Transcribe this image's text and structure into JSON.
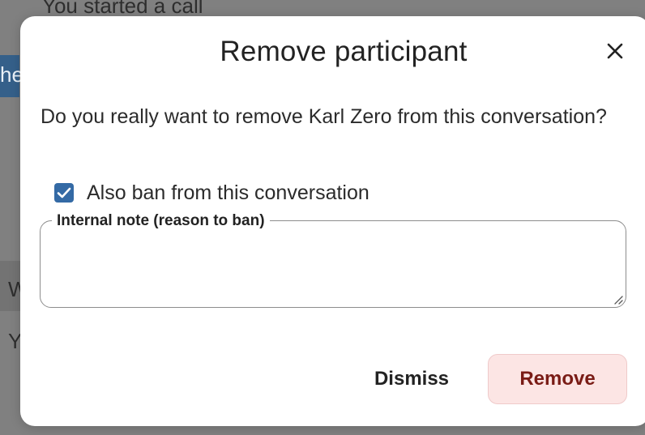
{
  "background": {
    "line_call": "You started a call",
    "line_blue": "he",
    "line_w": "W",
    "line_y": "Y"
  },
  "dialog": {
    "title": "Remove participant",
    "close_icon": "close-icon",
    "message": "Do you really want to remove Karl Zero from this conversation?",
    "ban_checkbox": {
      "checked": true,
      "label": "Also ban from this conversation"
    },
    "note": {
      "label": "Internal note (reason to ban)",
      "value": ""
    },
    "dismiss_label": "Dismiss",
    "remove_label": "Remove"
  },
  "colors": {
    "checkbox": "#346aa5",
    "remove_button_bg": "#fce5e4",
    "remove_button_text": "#7a1c16",
    "overlay": "#808080"
  }
}
